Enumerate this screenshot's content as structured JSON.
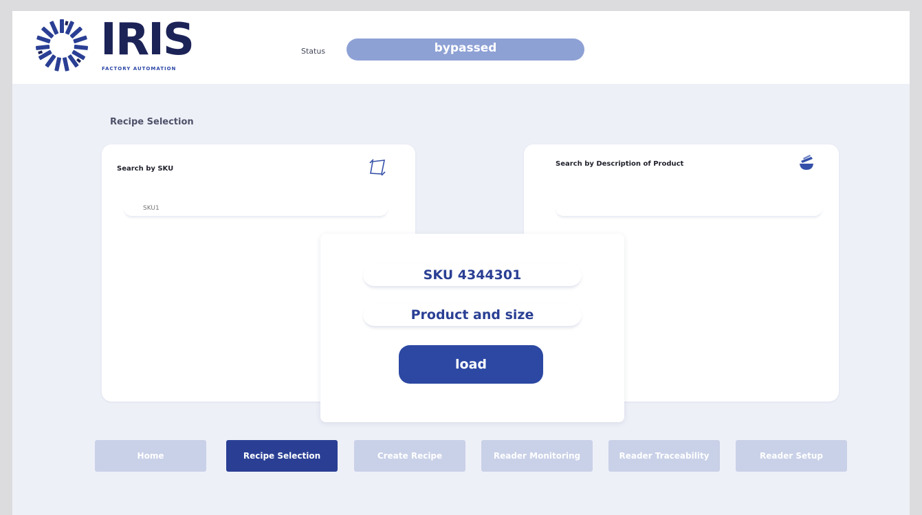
{
  "header": {
    "brand": "IRIS",
    "brand_sub": "FACTORY AUTOMATION",
    "logo_icon": "iris-sunburst-icon",
    "status_label": "Status",
    "status_value": "bypassed",
    "status_color": "#8ea1d5"
  },
  "page": {
    "section_title": "Recipe Selection"
  },
  "sku_card": {
    "title": "Search by SKU",
    "icon": "scan-frame-icon",
    "input_placeholder": "SKU1"
  },
  "desc_card": {
    "title": "Search by Description of Product",
    "icon": "stacked-bowls-icon",
    "input_placeholder": ""
  },
  "modal": {
    "sku_value": "SKU 4344301",
    "product_value": "Product and size",
    "load_label": "load",
    "accent": "#2c48a3"
  },
  "nav": {
    "items": [
      {
        "label": "Home",
        "active": false
      },
      {
        "label": "Recipe Selection",
        "active": true
      },
      {
        "label": "Create Recipe",
        "active": false
      },
      {
        "label": "Reader Monitoring",
        "active": false
      },
      {
        "label": "Reader Traceability",
        "active": false
      },
      {
        "label": "Reader Setup",
        "active": false
      }
    ],
    "active_color": "#2a3f94",
    "inactive_color": "#c9d1e8"
  }
}
